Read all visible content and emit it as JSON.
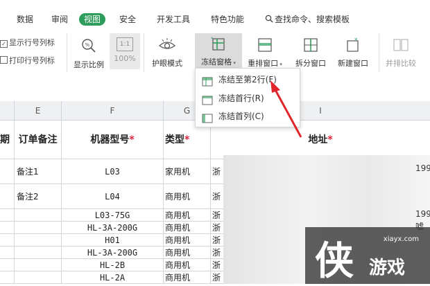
{
  "menubar": {
    "tabs": [
      "数据",
      "审阅",
      "视图",
      "安全",
      "开发工具",
      "特色功能"
    ],
    "active_tab": "视图",
    "search_label": "查找命令、搜索模板"
  },
  "toolbar": {
    "check_show_rownum": "显示行号列标",
    "check_print_rownum": "打印行号列标",
    "zoom_ratio": "显示比例",
    "zoom_100": "100%",
    "zoom_100_icon_text": "1:1",
    "eye_mode": "护眼模式",
    "freeze": "冻结窗格",
    "rearrange": "重排窗口",
    "split": "拆分窗口",
    "new_window": "新建窗口",
    "side_by_side": "并排比较"
  },
  "freeze_menu": {
    "items": [
      "冻结至第2行(F)",
      "冻结首行(R)",
      "冻结首列(C)"
    ]
  },
  "grid": {
    "col_letters": [
      "E",
      "F",
      "G",
      "I"
    ],
    "header_row": {
      "d": "期",
      "e": "订单备注",
      "f": "机器型号",
      "g": "类型",
      "i": "地址",
      "star": "*"
    },
    "rows": [
      {
        "e": "备注1",
        "f": "L03",
        "g": "家用机",
        "h": "浙",
        "right": "199"
      },
      {
        "e": "备注2",
        "f": "L04",
        "g": "商用机",
        "h": "浙",
        "right": ""
      },
      {
        "e": "",
        "f": "L03-75G",
        "g": "商用机",
        "h": "浙",
        "right": "199"
      },
      {
        "e": "",
        "f": "HL-3A-200G",
        "g": "商用机",
        "h": "浙",
        "right": "嘘"
      },
      {
        "e": "",
        "f": "H01",
        "g": "商用机",
        "h": "浙",
        "right": ""
      },
      {
        "e": "",
        "f": "HL-3A-200G",
        "g": "商用机",
        "h": "浙",
        "right": ""
      },
      {
        "e": "",
        "f": "HL-2B",
        "g": "商用机",
        "h": "浙",
        "right": ""
      },
      {
        "e": "",
        "f": "HL-2A",
        "g": "商用机",
        "h": "浙",
        "right": ""
      }
    ]
  },
  "watermark": {
    "url": "xiayx.com",
    "brand": "侠",
    "brand2": "游戏"
  },
  "colors": {
    "accent": "#2e9d5c",
    "arrow": "#e0262b",
    "star": "#d9001b"
  }
}
